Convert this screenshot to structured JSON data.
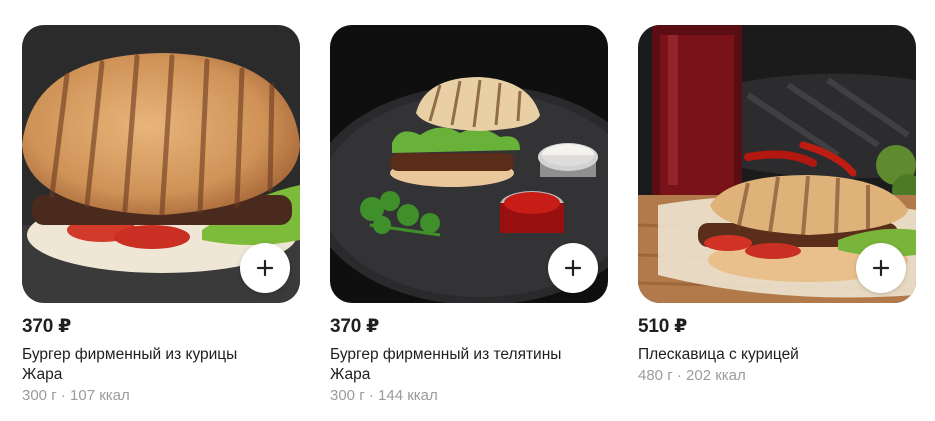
{
  "products": [
    {
      "price": "370 ₽",
      "name_line1": "Бургер фирменный из курицы",
      "name_line2": "Жара",
      "weight": "300 г",
      "separator": "·",
      "calories": "107 ккал"
    },
    {
      "price": "370 ₽",
      "name_line1": "Бургер фирменный из телятины",
      "name_line2": "Жара",
      "weight": "300 г",
      "separator": "·",
      "calories": "144 ккал"
    },
    {
      "price": "510 ₽",
      "name_line1": "Плескавица с курицей",
      "weight": "480 г",
      "separator": "·",
      "calories": "202 ккал"
    }
  ],
  "icons": {
    "add": "plus-icon"
  },
  "colors": {
    "text": "#21201f",
    "muted": "#9e9b98",
    "button_bg": "#ffffff"
  }
}
